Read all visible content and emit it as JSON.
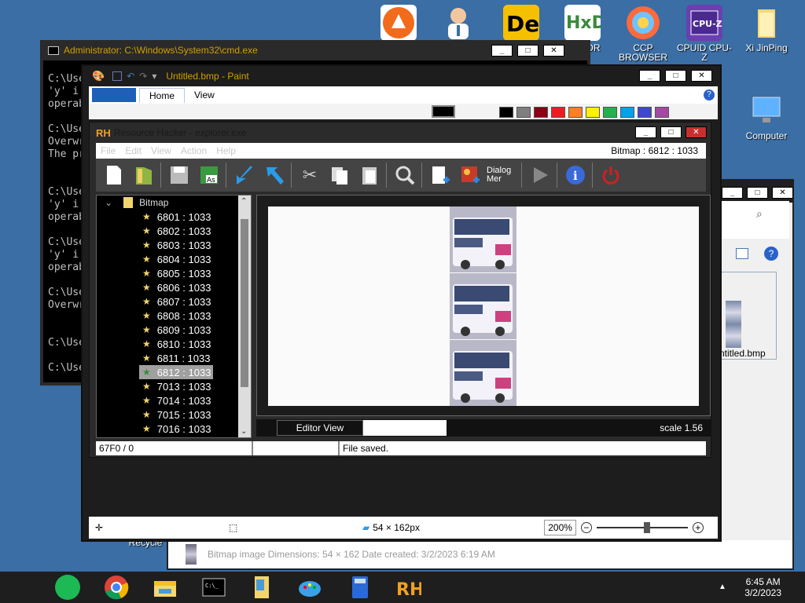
{
  "desktop": {
    "icons": [
      {
        "label": "",
        "icon": "avast-icon"
      },
      {
        "label": "",
        "icon": "doctor-icon"
      },
      {
        "label": "",
        "icon": "de-icon"
      },
      {
        "label": "EDITOR",
        "icon": "hxd-editor-icon"
      },
      {
        "label": "CCP BROWSER",
        "icon": "ccp-browser-icon"
      },
      {
        "label": "CPUID CPU-Z",
        "icon": "cpuz-icon"
      },
      {
        "label": "Xi JinPing",
        "icon": "folder-icon"
      },
      {
        "label": "Computer",
        "icon": "computer-icon"
      },
      {
        "label": "Recycle",
        "icon": "recycle-icon"
      }
    ]
  },
  "cmd": {
    "title": "Administrator: C:\\Windows\\System32\\cmd.exe",
    "lines": [
      "C:\\Use",
      "'y' i",
      "operab",
      "",
      "C:\\Use",
      "Overwr",
      "The pr",
      "",
      "",
      "C:\\Use",
      "'y' i",
      "operab",
      "",
      "C:\\Use",
      "'y' i",
      "operab",
      "",
      "C:\\Use",
      "Overwr",
      "",
      "",
      "C:\\Use",
      "",
      "C:\\Use"
    ]
  },
  "paint": {
    "title": "Untitled.bmp - Paint",
    "tabs": [
      "Home",
      "View"
    ],
    "status_size": "54 × 162px",
    "zoom": "200%",
    "palette": [
      "#000000",
      "#7f7f7f",
      "#880015",
      "#ed1c24",
      "#ff7f27",
      "#fff200",
      "#22b14c",
      "#00a2e8",
      "#3f48cc",
      "#a349a4"
    ]
  },
  "explorer": {
    "status": "Bitmap image    Dimensions: 54 × 162    Date created: 3/2/2023 6:19 AM",
    "file_label": "ntitled.bmp"
  },
  "rh": {
    "logo": "RH",
    "title": "Resource Hacker - explorer.exe",
    "menu": [
      "File",
      "Edit",
      "View",
      "Action",
      "Help"
    ],
    "resource_info": "Bitmap : 6812 : 1033",
    "dialog_merge_label": "Dialog Mer",
    "tree_root": "Bitmap",
    "tree_items": [
      "6801 : 1033",
      "6802 : 1033",
      "6803 : 1033",
      "6804 : 1033",
      "6805 : 1033",
      "6806 : 1033",
      "6807 : 1033",
      "6808 : 1033",
      "6809 : 1033",
      "6810 : 1033",
      "6811 : 1033",
      "6812 : 1033",
      "7013 : 1033",
      "7014 : 1033",
      "7015 : 1033",
      "7016 : 1033"
    ],
    "selected_index": 11,
    "editor_tab": "Editor View",
    "scale": "scale 1.56",
    "status_offset": "67F0 / 0",
    "status_message": "File saved."
  },
  "taskbar": {
    "time": "6:45 AM",
    "date": "3/2/2023",
    "apps": [
      "notes-icon",
      "chrome-icon",
      "file-explorer-icon",
      "cmd-icon",
      "folder-doc-icon",
      "paint-icon",
      "calculator-icon",
      "resource-hacker-icon"
    ]
  }
}
